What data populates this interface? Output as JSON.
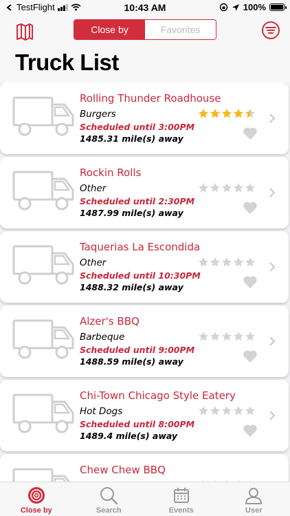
{
  "status_bar": {
    "carrier": "TestFlight",
    "time": "10:43 AM",
    "battery": "100%"
  },
  "nav": {
    "segments": [
      "Close by",
      "Favorites"
    ],
    "selected": "Close by"
  },
  "page_title": "Truck List",
  "colors": {
    "accent": "#d22d3d",
    "star_filled": "#f6b71a",
    "star_empty": "#d3d3d3"
  },
  "trucks": [
    {
      "name": "Rolling Thunder Roadhouse",
      "category": "Burgers",
      "schedule": "Scheduled until 3:00PM",
      "distance": "1485.31 mile(s) away",
      "rating": 4.5
    },
    {
      "name": "Rockin Rolls",
      "category": "Other",
      "schedule": "Scheduled until 2:30PM",
      "distance": "1487.99 mile(s) away",
      "rating": 0
    },
    {
      "name": "Taquerias La Escondida",
      "category": "Other",
      "schedule": "Scheduled until 10:30PM",
      "distance": "1488.32 mile(s) away",
      "rating": 0
    },
    {
      "name": "Alzer's BBQ",
      "category": "Barbeque",
      "schedule": "Scheduled until 9:00PM",
      "distance": "1488.59 mile(s) away",
      "rating": 0
    },
    {
      "name": "Chi-Town Chicago Style Eatery",
      "category": "Hot Dogs",
      "schedule": "Scheduled until 8:00PM",
      "distance": "1489.4 mile(s) away",
      "rating": 0
    },
    {
      "name": "Chew Chew BBQ",
      "category": "",
      "schedule": "",
      "distance": "",
      "rating": 0
    }
  ],
  "tabbar": {
    "tabs": [
      {
        "label": "Close by",
        "icon": "target-icon"
      },
      {
        "label": "Search",
        "icon": "search-icon"
      },
      {
        "label": "Events",
        "icon": "calendar-icon"
      },
      {
        "label": "User",
        "icon": "user-icon"
      }
    ],
    "active": "Close by"
  }
}
